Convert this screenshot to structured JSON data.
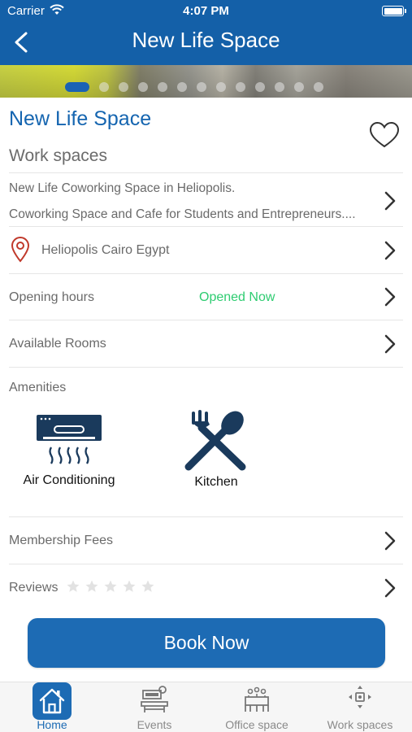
{
  "status_bar": {
    "carrier": "Carrier",
    "time": "4:07 PM"
  },
  "nav": {
    "title": "New Life Space"
  },
  "gallery": {
    "pages": 13,
    "current": 1
  },
  "place": {
    "name": "New Life Space",
    "category": "Work spaces",
    "description_line1": "New Life Coworking Space in Heliopolis.",
    "description_line2": "Coworking Space and Cafe for Students and Entrepreneurs....",
    "location": "Heliopolis Cairo Egypt"
  },
  "rows": {
    "opening_hours_label": "Opening hours",
    "opening_status": "Opened Now",
    "available_rooms_label": "Available Rooms",
    "amenities_label": "Amenities",
    "membership_label": "Membership Fees",
    "reviews_label": "Reviews",
    "rating": 0,
    "rating_max": 5
  },
  "amenities": [
    {
      "label": "Air Conditioning",
      "icon": "air-conditioner-icon"
    },
    {
      "label": "Kitchen",
      "icon": "fork-spoon-icon"
    }
  ],
  "book_button": "Book Now",
  "tabs": [
    {
      "label": "Home",
      "icon": "home-icon",
      "active": true
    },
    {
      "label": "Events",
      "icon": "events-icon",
      "active": false
    },
    {
      "label": "Office space",
      "icon": "office-space-icon",
      "active": false
    },
    {
      "label": "Work spaces",
      "icon": "work-spaces-icon",
      "active": false
    }
  ],
  "colors": {
    "brand": "#1460a8",
    "accent_button": "#1d6bb4",
    "open_status": "#2ecc71",
    "location_pin": "#c0392b",
    "amenity_icon": "#1a3a5c"
  }
}
